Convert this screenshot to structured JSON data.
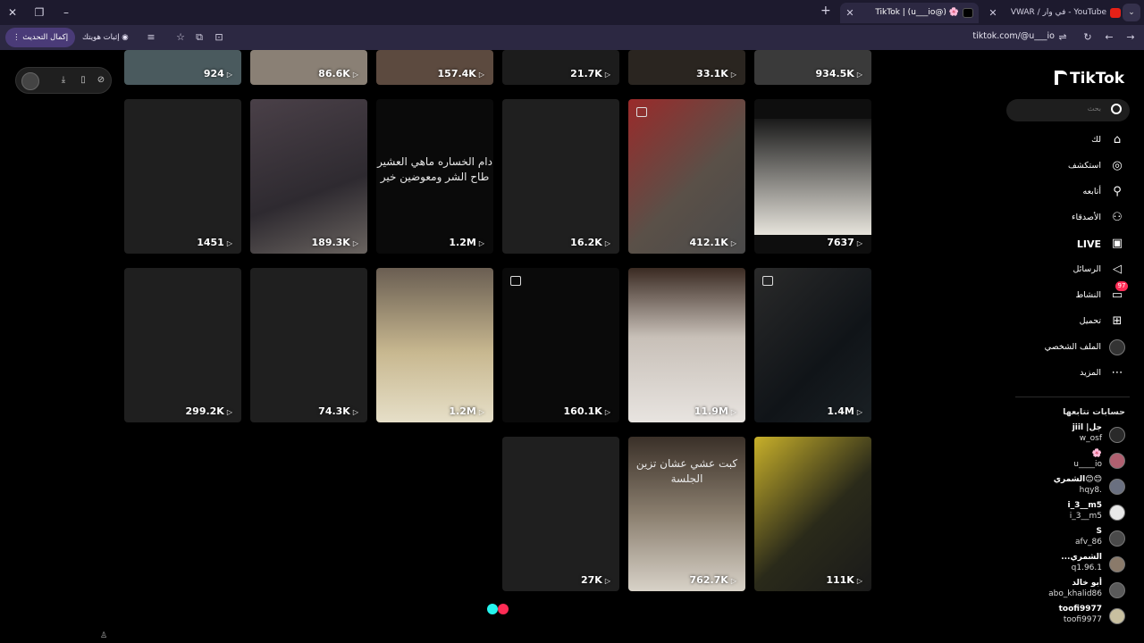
{
  "browser": {
    "tabs": [
      {
        "title": "TikTok | (u___io@) 🌸",
        "active": true
      },
      {
        "title": "VWAR / في وار - YouTube",
        "active": false
      }
    ],
    "address": "tiktok.com/@u___io",
    "update_label": "إكمال التحديث",
    "verify_label": "إثبات هويتك"
  },
  "tiktok": {
    "logo": "TikTok",
    "search_placeholder": "بحث",
    "nav": [
      {
        "label": "لك",
        "icon": "home-icon"
      },
      {
        "label": "استكشف",
        "icon": "compass-icon"
      },
      {
        "label": "أتابعه",
        "icon": "following-icon"
      },
      {
        "label": "الأصدقاء",
        "icon": "friends-icon"
      },
      {
        "label": "LIVE",
        "icon": "live-icon"
      },
      {
        "label": "الرسائل",
        "icon": "messages-icon"
      },
      {
        "label": "النشاط",
        "icon": "activity-icon",
        "badge": "97"
      },
      {
        "label": "تحميل",
        "icon": "upload-icon"
      },
      {
        "label": "الملف الشخصي",
        "icon": "profile-icon"
      },
      {
        "label": "المزيد",
        "icon": "more-icon"
      }
    ],
    "following_title": "حسابات تتابعها",
    "following": [
      {
        "name": "jiil |جل",
        "handle": "w_osf"
      },
      {
        "name": "🌸",
        "handle": "u____io"
      },
      {
        "name": "الشمري😊😊",
        "handle": "hqy8."
      },
      {
        "name": "i_3__m5",
        "handle": "i_3__m5"
      },
      {
        "name": "S",
        "handle": "afv_86"
      },
      {
        "name": "...الشمري",
        "handle": "q1.96.1"
      },
      {
        "name": "أبو خالد",
        "handle": "abo_khalid86"
      },
      {
        "name": "toofi9977",
        "handle": "toofi9977"
      }
    ]
  },
  "videos": {
    "row0": [
      "934.5K",
      "33.1K",
      "21.7K",
      "157.4K",
      "86.6K",
      "924"
    ],
    "row1": [
      "7637",
      "412.1K",
      "16.2K",
      "1.2M",
      "189.3K",
      "1451"
    ],
    "row2": [
      "1.4M",
      "11.9M",
      "160.1K",
      "1.2M",
      "74.3K",
      "299.2K"
    ],
    "row3": [
      "111K",
      "762.7K",
      "27K"
    ],
    "caption_1_3": "دام الخساره ماهي العشير طاح الشر ومعوضين خير",
    "caption_3_1": "كبت عشي عشان تزين الجلسة"
  }
}
